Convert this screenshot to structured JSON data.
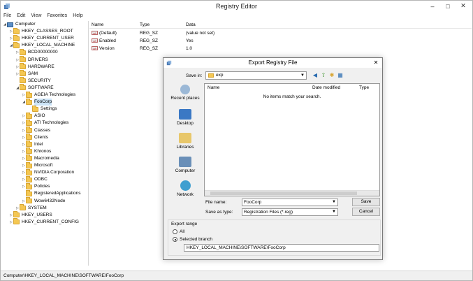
{
  "app": {
    "title": "Registry Editor"
  },
  "menu": [
    "File",
    "Edit",
    "View",
    "Favorites",
    "Help"
  ],
  "tree": [
    {
      "label": "Computer",
      "indent": 0,
      "arrow": "◢",
      "type": "computer"
    },
    {
      "label": "HKEY_CLASSES_ROOT",
      "indent": 1,
      "arrow": "▷"
    },
    {
      "label": "HKEY_CURRENT_USER",
      "indent": 1,
      "arrow": "▷"
    },
    {
      "label": "HKEY_LOCAL_MACHINE",
      "indent": 1,
      "arrow": "◢"
    },
    {
      "label": "BCD00000000",
      "indent": 2,
      "arrow": "▷"
    },
    {
      "label": "DRIVERS",
      "indent": 2,
      "arrow": "▷"
    },
    {
      "label": "HARDWARE",
      "indent": 2,
      "arrow": "▷"
    },
    {
      "label": "SAM",
      "indent": 2,
      "arrow": "▷"
    },
    {
      "label": "SECURITY",
      "indent": 2,
      "arrow": ""
    },
    {
      "label": "SOFTWARE",
      "indent": 2,
      "arrow": "◢"
    },
    {
      "label": "AGEIA Technologies",
      "indent": 3,
      "arrow": "▷"
    },
    {
      "label": "FooCorp",
      "indent": 3,
      "arrow": "◢"
    },
    {
      "label": "Settings",
      "indent": 4,
      "arrow": ""
    },
    {
      "label": "ASIO",
      "indent": 3,
      "arrow": "▷"
    },
    {
      "label": "ATI Technologies",
      "indent": 3,
      "arrow": "▷"
    },
    {
      "label": "Classes",
      "indent": 3,
      "arrow": "▷"
    },
    {
      "label": "Clients",
      "indent": 3,
      "arrow": "▷"
    },
    {
      "label": "Intel",
      "indent": 3,
      "arrow": "▷"
    },
    {
      "label": "Khronos",
      "indent": 3,
      "arrow": "▷"
    },
    {
      "label": "Macromedia",
      "indent": 3,
      "arrow": "▷"
    },
    {
      "label": "Microsoft",
      "indent": 3,
      "arrow": "▷"
    },
    {
      "label": "NVIDIA Corporation",
      "indent": 3,
      "arrow": "▷"
    },
    {
      "label": "ODBC",
      "indent": 3,
      "arrow": "▷"
    },
    {
      "label": "Policies",
      "indent": 3,
      "arrow": "▷"
    },
    {
      "label": "RegisteredApplications",
      "indent": 3,
      "arrow": ""
    },
    {
      "label": "Wow6432Node",
      "indent": 3,
      "arrow": "▷"
    },
    {
      "label": "SYSTEM",
      "indent": 2,
      "arrow": "▷"
    },
    {
      "label": "HKEY_USERS",
      "indent": 1,
      "arrow": "▷"
    },
    {
      "label": "HKEY_CURRENT_CONFIG",
      "indent": 1,
      "arrow": "▷"
    }
  ],
  "list": {
    "headers": {
      "name": "Name",
      "type": "Type",
      "data": "Data"
    },
    "rows": [
      {
        "name": "(Default)",
        "type": "REG_SZ",
        "data": "(value not set)"
      },
      {
        "name": "Enabled",
        "type": "REG_SZ",
        "data": "Yes"
      },
      {
        "name": "Version",
        "type": "REG_SZ",
        "data": "1.0"
      }
    ]
  },
  "status": "Computer\\HKEY_LOCAL_MACHINE\\SOFTWARE\\FooCorp",
  "dialog": {
    "title": "Export Registry File",
    "save_in_label": "Save in:",
    "save_in_value": "exp",
    "places": [
      "Recent places",
      "Desktop",
      "Libraries",
      "Computer",
      "Network"
    ],
    "columns": {
      "name": "Name",
      "date": "Date modified",
      "type": "Type"
    },
    "empty_message": "No items match your search.",
    "file_name_label": "File name:",
    "file_name_value": "FooCorp",
    "save_as_label": "Save as type:",
    "save_as_value": "Registration Files (*.reg)",
    "save_button": "Save",
    "cancel_button": "Cancel",
    "export_range_label": "Export range",
    "radio_all": "All",
    "radio_selected": "Selected branch",
    "branch_value": "HKEY_LOCAL_MACHINE\\SOFTWARE\\FooCorp"
  },
  "colors": {
    "folder": "#f4c752",
    "selection": "#cce4f7"
  }
}
